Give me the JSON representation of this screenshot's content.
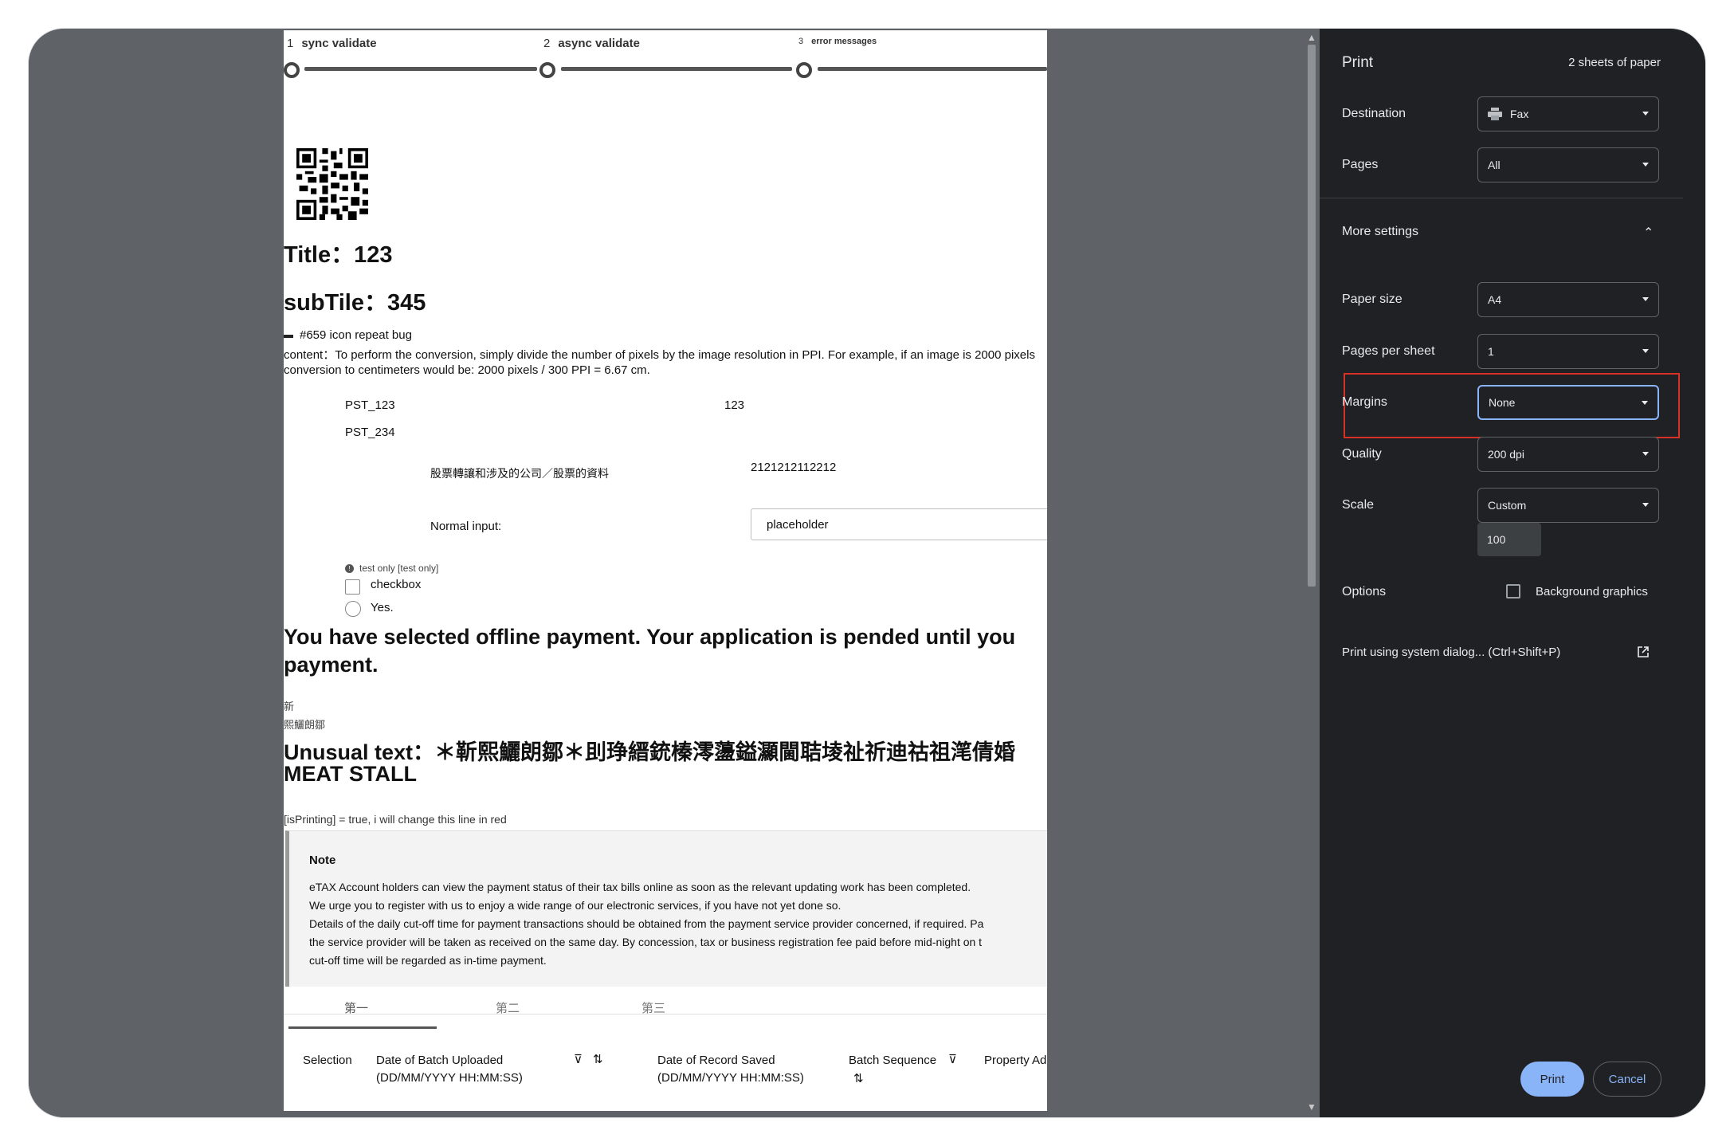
{
  "preview": {
    "steps": [
      {
        "num": "1",
        "label": "sync validate"
      },
      {
        "num": "2",
        "label": "async validate"
      },
      {
        "num": "3",
        "label": "error messages"
      }
    ],
    "title": "Title：123",
    "subtitle": "subTile：345",
    "bug_line": "#659 icon repeat bug",
    "content_line1": "content：To perform the conversion, simply divide the number of pixels by the image resolution in PPI. For example, if an image is 2000 pixels",
    "content_line2": "conversion to centimeters would be: 2000 pixels / 300 PPI = 6.67 cm.",
    "pst1": "PST_123",
    "pst1_value": "123",
    "pst2": "PST_234",
    "chinese_label": "股票轉讓和涉及的公司／股票的資料",
    "chinese_value": "2121212112212",
    "normal_input_label": "Normal input:",
    "normal_input_value": "placeholder",
    "test_only": "test only [test only]",
    "checkbox_label": "checkbox",
    "radio_label": "Yes.",
    "offline_line1": "You have selected offline payment. Your application is pended until you",
    "offline_line2": "payment.",
    "small_glyph1": "新",
    "small_glyph2": "熙鱺朗鄒",
    "unusual_line1": "Unusual text：＊靳熙鱺朗鄒＊刞琤縉銃榛澪蘯鎰灦閫聐堎祉祈迪祜祖滗倩婚",
    "unusual_line2": "MEAT STALL",
    "printing_line": "[isPrinting] = true, i will change this line in red",
    "note": {
      "title": "Note",
      "lines": [
        "eTAX Account holders can view the payment status of their tax bills online as soon as the relevant updating work has been completed.",
        "We urge you to register with us to enjoy a wide range of our electronic services, if you have not yet done so.",
        "Details of the daily cut-off time for payment transactions should be obtained from the payment service provider concerned, if required.  Pa",
        "the service provider will be taken as received on the same day.  By concession, tax or business registration fee paid before mid-night on t",
        "cut-off time will be regarded as in-time payment."
      ]
    },
    "tabs": [
      "第一",
      "第二",
      "第三"
    ],
    "table_headers": {
      "selection": "Selection",
      "batch_uploaded_1": "Date of Batch Uploaded",
      "batch_uploaded_2": "(DD/MM/YYYY HH:MM:SS)",
      "record_saved_1": "Date of Record Saved",
      "record_saved_2": "(DD/MM/YYYY HH:MM:SS)",
      "batch_sequence": "Batch Sequence",
      "property": "Property Ad"
    }
  },
  "panel": {
    "title": "Print",
    "sheets": "2 sheets of paper",
    "destination_label": "Destination",
    "destination_value": "Fax",
    "pages_label": "Pages",
    "pages_value": "All",
    "more_settings": "More settings",
    "paper_size_label": "Paper size",
    "paper_size_value": "A4",
    "pages_per_sheet_label": "Pages per sheet",
    "pages_per_sheet_value": "1",
    "margins_label": "Margins",
    "margins_value": "None",
    "quality_label": "Quality",
    "quality_value": "200 dpi",
    "scale_label": "Scale",
    "scale_value": "Custom",
    "scale_custom": "100",
    "options_label": "Options",
    "background_graphics": "Background graphics",
    "system_dialog": "Print using system dialog... (Ctrl+Shift+P)",
    "print_button": "Print",
    "cancel_button": "Cancel"
  },
  "colors": {
    "accent": "#8ab4f8",
    "highlight_box": "#d93025",
    "panel_bg": "#202124",
    "preview_bg": "#5f6368"
  }
}
